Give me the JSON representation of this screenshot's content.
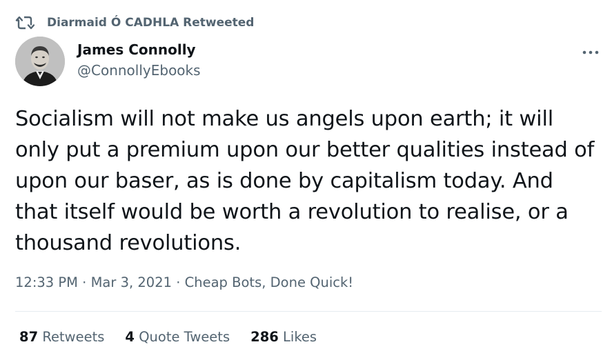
{
  "retweet": {
    "icon": "retweet-icon",
    "label": "Diarmaid Ó CADHLA Retweeted"
  },
  "author": {
    "name": "James Connolly",
    "handle": "@ConnollyEbooks",
    "avatar": "avatar-portrait"
  },
  "more_icon": "more-options-icon",
  "tweet": {
    "lines": [
      "Socialism will not make us angels upon earth; it will",
      "only put a premium upon our better qualities instead of",
      "upon our baser, as is done by capitalism today. And",
      "that itself would be worth a revolution to realise, or a",
      "thousand revolutions."
    ]
  },
  "meta": {
    "time": "12:33 PM",
    "sep1": " · ",
    "date": "Mar 3, 2021",
    "sep2": " · ",
    "source": "Cheap Bots, Done Quick!"
  },
  "stats": {
    "retweets_count": "87",
    "retweets_label": "Retweets",
    "quotes_count": "4",
    "quotes_label": "Quote Tweets",
    "likes_count": "286",
    "likes_label": "Likes"
  },
  "colors": {
    "primary_text": "#0f1419",
    "secondary_text": "#536471",
    "divider": "#e6ecf0"
  }
}
